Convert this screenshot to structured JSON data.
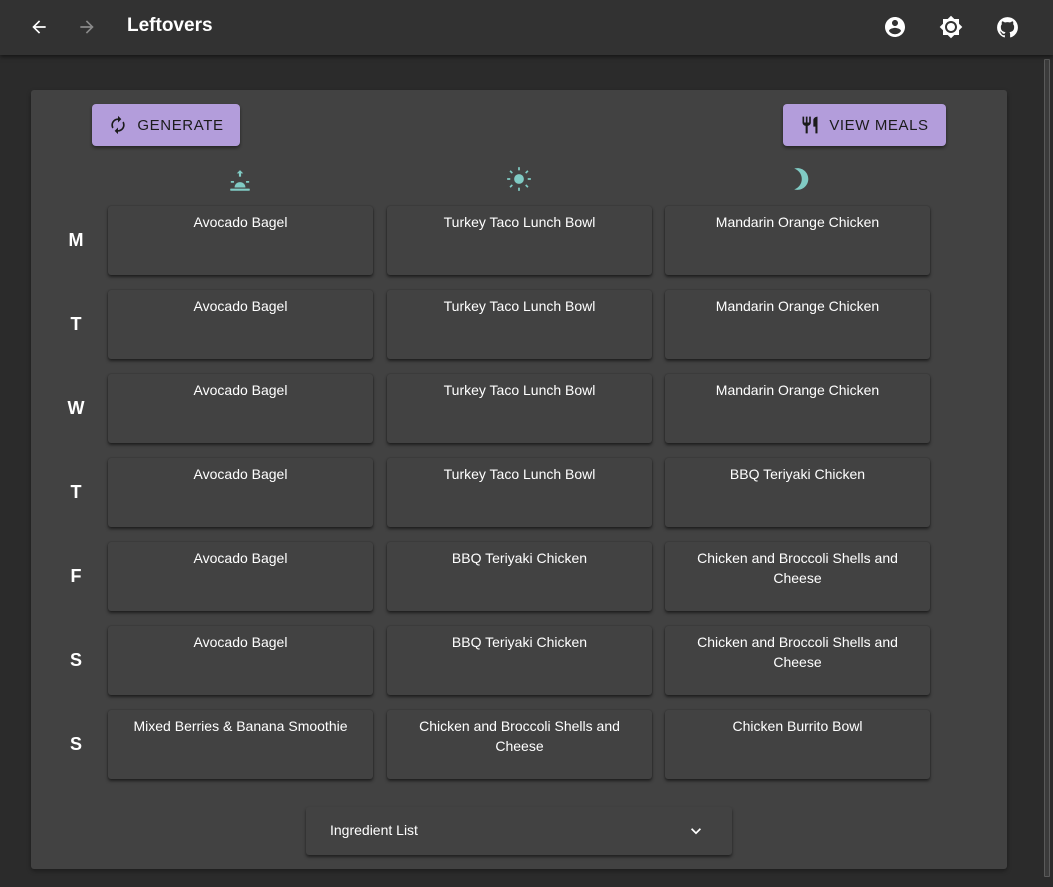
{
  "app": {
    "title": "Leftovers"
  },
  "header": {
    "back_icon": "arrow-left-icon",
    "forward_icon": "arrow-right-icon",
    "account_icon": "account-circle-icon",
    "theme_icon": "brightness-icon",
    "github_icon": "github-icon"
  },
  "toolbar": {
    "generate_label": "GENERATE",
    "view_meals_label": "VIEW MEALS"
  },
  "slots": [
    {
      "name": "breakfast",
      "icon": "sunrise-icon"
    },
    {
      "name": "lunch",
      "icon": "sun-icon"
    },
    {
      "name": "dinner",
      "icon": "moon-icon"
    }
  ],
  "days": [
    {
      "label": "M",
      "meals": [
        "Avocado Bagel",
        "Turkey Taco Lunch Bowl",
        "Mandarin Orange Chicken"
      ]
    },
    {
      "label": "T",
      "meals": [
        "Avocado Bagel",
        "Turkey Taco Lunch Bowl",
        "Mandarin Orange Chicken"
      ]
    },
    {
      "label": "W",
      "meals": [
        "Avocado Bagel",
        "Turkey Taco Lunch Bowl",
        "Mandarin Orange Chicken"
      ]
    },
    {
      "label": "T",
      "meals": [
        "Avocado Bagel",
        "Turkey Taco Lunch Bowl",
        "BBQ Teriyaki Chicken"
      ]
    },
    {
      "label": "F",
      "meals": [
        "Avocado Bagel",
        "BBQ Teriyaki Chicken",
        "Chicken and Broccoli Shells and Cheese"
      ]
    },
    {
      "label": "S",
      "meals": [
        "Avocado Bagel",
        "BBQ Teriyaki Chicken",
        "Chicken and Broccoli Shells and Cheese"
      ]
    },
    {
      "label": "S",
      "meals": [
        "Mixed Berries & Banana Smoothie",
        "Chicken and Broccoli Shells and Cheese",
        "Chicken Burrito Bowl"
      ]
    }
  ],
  "ingredients": {
    "label": "Ingredient List"
  },
  "colors": {
    "accent": "#b39ddb",
    "icon_teal": "#80cbc4",
    "background": "#2b2b2b",
    "panel": "#424242",
    "appbar": "#323232"
  }
}
